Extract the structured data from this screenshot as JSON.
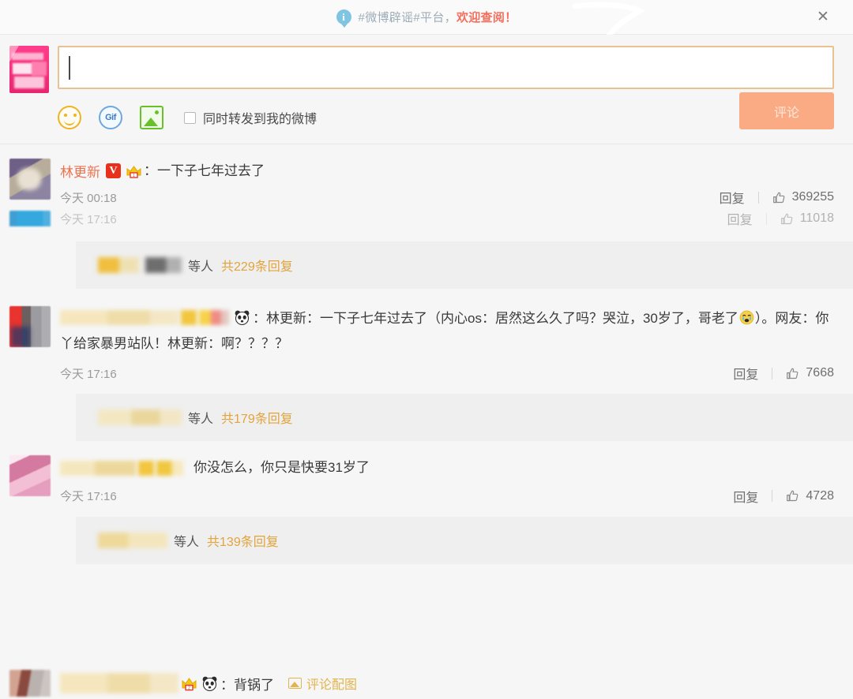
{
  "banner": {
    "info_icon": "info-icon",
    "text_main": "#微博辟谣#平台，",
    "text_highlight": "欢迎查阅！",
    "close_label": "✕",
    "highlight_color": "#f2705e"
  },
  "composer": {
    "avatar_name": "my-avatar",
    "input_value": "",
    "input_placeholder": "",
    "tools": [
      {
        "name": "emoji-icon",
        "label": ""
      },
      {
        "name": "gif-icon",
        "label": "Gif"
      },
      {
        "name": "image-icon",
        "label": ""
      }
    ],
    "repost_checkbox": {
      "checked": false,
      "label": "同时转发到我的微博"
    },
    "submit_label": "评论",
    "submit_color": "#fbab83",
    "border_color": "#e8c38f"
  },
  "comments": [
    {
      "avatar": "av-purple",
      "username": "林更新",
      "verified_badge": "V",
      "crown_badge": "crown-icon",
      "colon": "：",
      "text": "一下子七年过去了",
      "time": "今天 00:18",
      "reply_label": "回复",
      "like_count": "369255",
      "reply_strip": null
    },
    {
      "avatar": "clip-av-blue",
      "username": "",
      "time": "今天 17:16",
      "reply_label": "回复",
      "like_count": "11018",
      "clipped": true,
      "reply_strip": {
        "suffix": "等人",
        "link": "共229条回复"
      }
    },
    {
      "avatar": "av-red",
      "username": "",
      "colon": "：",
      "text": "林更新：一下子七年过去了（内心os：居然这么久了吗？哭泣，30岁了，哥老了",
      "text2": "）。网友：你丫给家暴男站队！林更新：啊？？？？",
      "time": "今天 17:16",
      "reply_label": "回复",
      "like_count": "7668",
      "reply_strip": {
        "suffix": "等人",
        "link": "共179条回复"
      }
    },
    {
      "avatar": "av-pink2",
      "username": "",
      "text": "你没怎么，你只是快要31岁了",
      "time": "今天 17:16",
      "reply_label": "回复",
      "like_count": "4728",
      "reply_strip": {
        "suffix": "等人",
        "link": "共139条回复"
      }
    }
  ],
  "bottom_row": {
    "avatar": "av-brown",
    "colon": "：",
    "text": "背锅了",
    "pic_link": "评论配图",
    "link_color": "#e2b44c"
  },
  "colors": {
    "page_bg": "#f6f6f6",
    "strip_bg": "#efefef",
    "username": "#eb7350",
    "link_orange": "#e2a43c",
    "text": "#3a3a3a",
    "muted": "#9a9a9a"
  }
}
